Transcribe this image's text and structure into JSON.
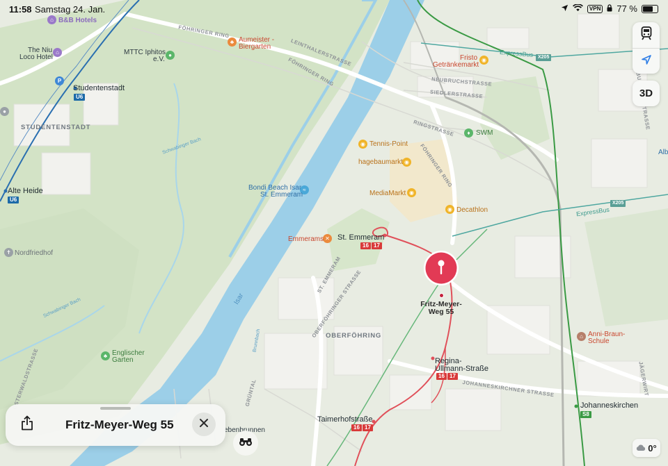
{
  "status_bar": {
    "time": "11:58",
    "date": "Samstag 24. Jan.",
    "vpn": "VPN",
    "battery": "77 %",
    "battery_level": 0.77
  },
  "map_labels": {
    "bb_hotels": "B&B Hotels",
    "the_niu_1": "The Niu",
    "the_niu_2": "Loco Hotel",
    "mttc_1": "MTTC Iphitos",
    "mttc_2": "e.V.",
    "aumeister_1": "Aumeister -",
    "aumeister_2": "Biergarten",
    "foehringer_ring": "FÖHRINGER RING",
    "foehringer_ring_2": "FÖHRINGER RING",
    "foehringer_ring_3": "FÖHRINGER RING",
    "leinthalerstrasse": "LEINTHALERSTRASSE",
    "fristo_1": "Fristo",
    "fristo_2": "Getränkemarkt",
    "expressbus": "ExpressBus",
    "expressbus_2": "ExpressBus",
    "x205": "X205",
    "x205_2": "X205",
    "neubruchstrasse": "NEUBRUCHSTRASSE",
    "siedlerstrasse": "SIEDLERSTRASSE",
    "ringstrasse": "RINGSTRASSE",
    "studentenstadt_station": "Studentenstadt",
    "studentenstadt_district": "STUDENTENSTADT",
    "u6": "U6",
    "u6_2": "U6",
    "alte_heide": "Alte Heide",
    "tennis_point": "Tennis-Point",
    "hagebaumarkt": "hagebaumarkt",
    "swm": "SWM",
    "bondi_1": "Bondi Beach Isar",
    "bondi_2": "St. Emmeram",
    "mediamarkt": "MediaMarkt",
    "decathlon": "Decathlon",
    "emmerams": "Emmerams",
    "st_emmeram": "St. Emmeram",
    "nordfriedhof": "Nordfriedhof",
    "schwabinger_bach": "Schwabinger Bach",
    "schwabinger_bach_2": "Schwabinger Bach",
    "isar": "Isar",
    "st_emmeram_street": "ST. EMMERAM",
    "oberfoehringer_strasse": "OBERFÖHRINGER STRASSE",
    "oberfoehring": "OBERFÖHRING",
    "anni_braun_1": "Anni-Braun-",
    "anni_braun_2": "Schule",
    "englischer_1": "Englischer",
    "englischer_2": "Garten",
    "regina_1": "Regina-",
    "regina_2": "Ullmann-Straße",
    "johanneskirchner_strasse": "JOHANNESKIRCHNER STRASSE",
    "johanneskirchen": "Johanneskirchen",
    "s8": "S8",
    "taimerhofstrasse": "Taimerhofstraße",
    "brunnbach": "Brunnbach",
    "tram_16": "16",
    "tram_17": "17",
    "ebenbrunnen": "ebenbrunnen",
    "osterwaldstrasse": "OSTERWALDSTRASSE",
    "gruental": "GRÜNTAL",
    "buschingstrasse": "BUSCHINGSTRASSE",
    "jaegerwirt": "JÄGERWIRT",
    "alb": "Alb",
    "pin_label_1": "Fritz-Meyer-",
    "pin_label_2": "Weg 55"
  },
  "controls": {
    "transit_icon": "tram-icon",
    "locate_icon": "location-arrow-icon",
    "three_d_label": "3D"
  },
  "place_card": {
    "title": "Fritz-Meyer-Weg 55",
    "share_icon": "share-icon",
    "close_icon": "close-icon"
  },
  "lookaround_icon": "binoculars-icon",
  "weather": {
    "icon": "cloud-icon",
    "temperature": "0°"
  },
  "colors": {
    "pin": "#e23a55",
    "tram_line": "#e0505a",
    "ubahn": "#1c6aa8",
    "sbahn": "#3a9a44",
    "water": "#9ccfe8",
    "park": "#cfe2c2"
  }
}
